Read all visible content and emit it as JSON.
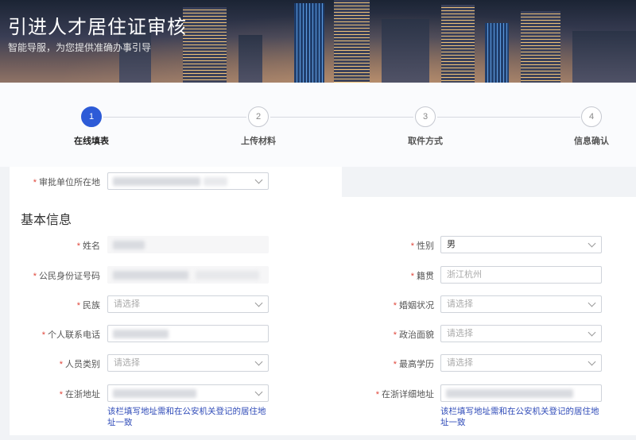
{
  "banner": {
    "title": "引进人才居住证审核",
    "subtitle": "智能导服，为您提供准确办事引导"
  },
  "steps": [
    {
      "num": "1",
      "label": "在线填表",
      "active": true
    },
    {
      "num": "2",
      "label": "上传材料",
      "active": false
    },
    {
      "num": "3",
      "label": "取件方式",
      "active": false
    },
    {
      "num": "4",
      "label": "信息确认",
      "active": false
    }
  ],
  "form": {
    "approval_unit": {
      "label": "审批单位所在地"
    },
    "section_title": "基本信息",
    "required_mark": "*",
    "name": {
      "label": "姓名"
    },
    "gender": {
      "label": "性别",
      "value": "男"
    },
    "id_number": {
      "label": "公民身份证号码"
    },
    "native_place": {
      "label": "籍贯",
      "placeholder": "浙江杭州"
    },
    "ethnicity": {
      "label": "民族",
      "placeholder": "请选择"
    },
    "marital_status": {
      "label": "婚姻状况",
      "placeholder": "请选择"
    },
    "phone": {
      "label": "个人联系电话"
    },
    "political_status": {
      "label": "政治面貌",
      "placeholder": "请选择"
    },
    "person_type": {
      "label": "人员类别",
      "placeholder": "请选择"
    },
    "education": {
      "label": "最高学历",
      "placeholder": "请选择"
    },
    "zj_address": {
      "label": "在浙地址",
      "hint": "该栏填写地址需和在公安机关登记的居住地址一致"
    },
    "zj_detail_address": {
      "label": "在浙详细地址",
      "hint": "该栏填写地址需和在公安机关登记的居住地址一致"
    }
  }
}
